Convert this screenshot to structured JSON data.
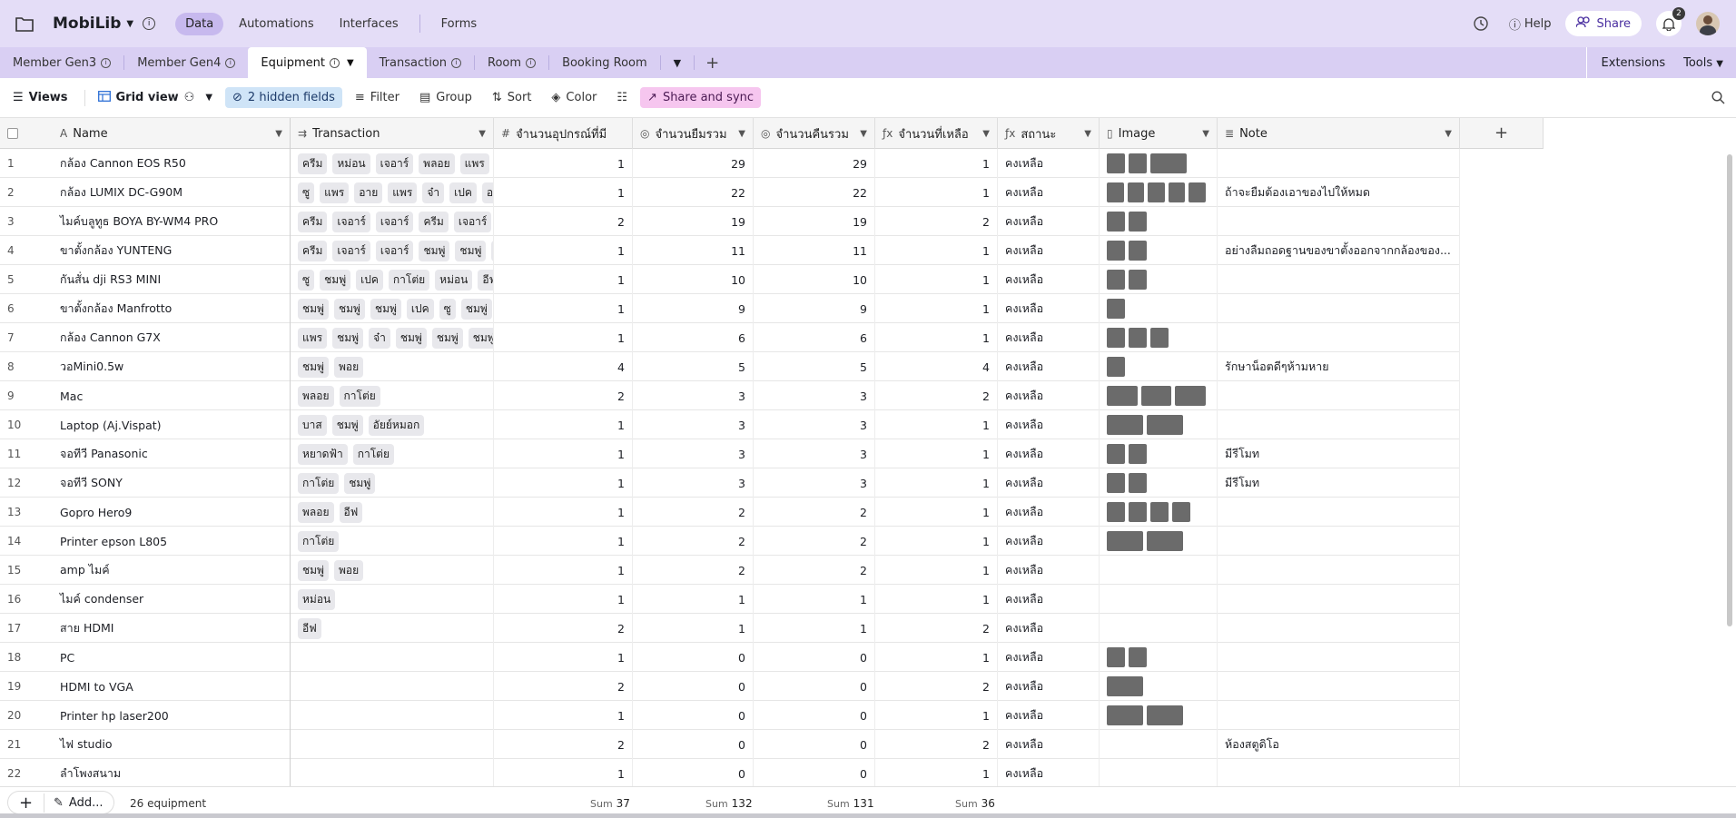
{
  "app": {
    "base_name": "MobiLib",
    "nav": [
      "Data",
      "Automations",
      "Interfaces",
      "Forms"
    ],
    "help_label": "Help",
    "share_label": "Share",
    "notification_count": "2"
  },
  "tabs": {
    "items": [
      "Member Gen3",
      "Member Gen4",
      "Equipment",
      "Transaction",
      "Room",
      "Booking Room"
    ],
    "active": "Equipment",
    "extensions_label": "Extensions",
    "tools_label": "Tools"
  },
  "toolbar": {
    "views_label": "Views",
    "grid_view_label": "Grid view",
    "hidden_fields_label": "2 hidden fields",
    "filter_label": "Filter",
    "group_label": "Group",
    "sort_label": "Sort",
    "color_label": "Color",
    "share_sync_label": "Share and sync"
  },
  "columns": [
    {
      "label": "Name",
      "icon": "A"
    },
    {
      "label": "Transaction",
      "icon": "link"
    },
    {
      "label": "จำนวนอุปกรณ์ที่มี",
      "icon": "#"
    },
    {
      "label": "จำนวนยืมรวม",
      "icon": "rollup"
    },
    {
      "label": "จำนวนคืนรวม",
      "icon": "rollup"
    },
    {
      "label": "จำนวนที่เหลือ",
      "icon": "fx"
    },
    {
      "label": "สถานะ",
      "icon": "fx"
    },
    {
      "label": "Image",
      "icon": "file"
    },
    {
      "label": "Note",
      "icon": "text"
    }
  ],
  "rows": [
    {
      "id": "1",
      "name": "กล้อง Cannon EOS R50",
      "tx": [
        "ครีม",
        "หม่อน",
        "เจอาร์",
        "พลอย",
        "แพร",
        "เจอ"
      ],
      "have": "1",
      "borrow": "29",
      "ret": "29",
      "left": "1",
      "status": "คงเหลือ",
      "images": [
        "sq",
        "sq",
        "wide"
      ],
      "note": ""
    },
    {
      "id": "2",
      "name": "กล้อง LUMIX DC-G90M",
      "tx": [
        "ซู",
        "แพร",
        "อาย",
        "แพร",
        "จ๋า",
        "เปค",
        "อาย",
        "จ"
      ],
      "have": "1",
      "borrow": "22",
      "ret": "22",
      "left": "1",
      "status": "คงเหลือ",
      "images": [
        "sq",
        "sq",
        "sq",
        "sq",
        "sq"
      ],
      "note": "ถ้าจะยืมต้องเอาของไปให้หมด"
    },
    {
      "id": "3",
      "name": "ไมค์บลูทูธ BOYA BY-WM4 PRO",
      "tx": [
        "ครีม",
        "เจอาร์",
        "เจอาร์",
        "ครีม",
        "เจอาร์",
        "พลอ"
      ],
      "have": "2",
      "borrow": "19",
      "ret": "19",
      "left": "2",
      "status": "คงเหลือ",
      "images": [
        "sq",
        "sq"
      ],
      "note": ""
    },
    {
      "id": "4",
      "name": "ขาตั้งกล้อง YUNTENG",
      "tx": [
        "ครีม",
        "เจอาร์",
        "เจอาร์",
        "ชมพู่",
        "ชมพู่",
        "ขิ่น"
      ],
      "have": "1",
      "borrow": "11",
      "ret": "11",
      "left": "1",
      "status": "คงเหลือ",
      "images": [
        "sq",
        "sq"
      ],
      "note": "อย่างลืมถอดฐานของขาตั้งออกจากกล้องของ..."
    },
    {
      "id": "5",
      "name": "กันสั่น dji RS3 MINI",
      "tx": [
        "ซู",
        "ชมพู่",
        "เปค",
        "กาโต่ย",
        "หม่อน",
        "อีฟ",
        "ซ"
      ],
      "have": "1",
      "borrow": "10",
      "ret": "10",
      "left": "1",
      "status": "คงเหลือ",
      "images": [
        "sq",
        "sq"
      ],
      "note": ""
    },
    {
      "id": "6",
      "name": "ขาตั้งกล้อง Manfrotto",
      "tx": [
        "ชมพู่",
        "ชมพู่",
        "ชมพู่",
        "เปค",
        "ซู",
        "ชมพู่",
        "ชม"
      ],
      "have": "1",
      "borrow": "9",
      "ret": "9",
      "left": "1",
      "status": "คงเหลือ",
      "images": [
        "sq"
      ],
      "note": ""
    },
    {
      "id": "7",
      "name": "กล้อง Cannon G7X",
      "tx": [
        "แพร",
        "ชมพู่",
        "จ๋า",
        "ชมพู่",
        "ชมพู่",
        "ชมพู่"
      ],
      "have": "1",
      "borrow": "6",
      "ret": "6",
      "left": "1",
      "status": "คงเหลือ",
      "images": [
        "sq",
        "sq",
        "sq"
      ],
      "note": ""
    },
    {
      "id": "8",
      "name": "วอMini0.5w",
      "tx": [
        "ชมพู่",
        "พอย"
      ],
      "have": "4",
      "borrow": "5",
      "ret": "5",
      "left": "4",
      "status": "คงเหลือ",
      "images": [
        "sq"
      ],
      "note": "รักษาน็อตดีๆห้ามหาย"
    },
    {
      "id": "9",
      "name": "Mac",
      "tx": [
        "พลอย",
        "กาโต่ย"
      ],
      "have": "2",
      "borrow": "3",
      "ret": "3",
      "left": "2",
      "status": "คงเหลือ",
      "images": [
        "wide",
        "wide",
        "wide"
      ],
      "note": ""
    },
    {
      "id": "10",
      "name": "Laptop (Aj.Vispat)",
      "tx": [
        "บาส",
        "ชมพู่",
        "อัยย์หมอก"
      ],
      "have": "1",
      "borrow": "3",
      "ret": "3",
      "left": "1",
      "status": "คงเหลือ",
      "images": [
        "wide",
        "wide"
      ],
      "note": ""
    },
    {
      "id": "11",
      "name": "จอทีวี Panasonic",
      "tx": [
        "หยาดฟ้า",
        "กาโต่ย"
      ],
      "have": "1",
      "borrow": "3",
      "ret": "3",
      "left": "1",
      "status": "คงเหลือ",
      "images": [
        "sq",
        "sq"
      ],
      "note": "มีรีโมท"
    },
    {
      "id": "12",
      "name": "จอทีวี SONY",
      "tx": [
        "กาโต่ย",
        "ชมพู่"
      ],
      "have": "1",
      "borrow": "3",
      "ret": "3",
      "left": "1",
      "status": "คงเหลือ",
      "images": [
        "sq",
        "sq"
      ],
      "note": "มีรีโมท"
    },
    {
      "id": "13",
      "name": "Gopro Hero9",
      "tx": [
        "พลอย",
        "อีฟ"
      ],
      "have": "1",
      "borrow": "2",
      "ret": "2",
      "left": "1",
      "status": "คงเหลือ",
      "images": [
        "sq",
        "sq",
        "sq",
        "sq"
      ],
      "note": ""
    },
    {
      "id": "14",
      "name": "Printer epson L805",
      "tx": [
        "กาโต่ย"
      ],
      "have": "1",
      "borrow": "2",
      "ret": "2",
      "left": "1",
      "status": "คงเหลือ",
      "images": [
        "wide",
        "wide"
      ],
      "note": ""
    },
    {
      "id": "15",
      "name": "amp ไมค์",
      "tx": [
        "ชมพู่",
        "พอย"
      ],
      "have": "1",
      "borrow": "2",
      "ret": "2",
      "left": "1",
      "status": "คงเหลือ",
      "images": [],
      "note": ""
    },
    {
      "id": "16",
      "name": "ไมค์ condenser",
      "tx": [
        "หม่อน"
      ],
      "have": "1",
      "borrow": "1",
      "ret": "1",
      "left": "1",
      "status": "คงเหลือ",
      "images": [],
      "note": ""
    },
    {
      "id": "17",
      "name": "สาย HDMI",
      "tx": [
        "อีฟ"
      ],
      "have": "2",
      "borrow": "1",
      "ret": "1",
      "left": "2",
      "status": "คงเหลือ",
      "images": [],
      "note": ""
    },
    {
      "id": "18",
      "name": "PC",
      "tx": [],
      "have": "1",
      "borrow": "0",
      "ret": "0",
      "left": "1",
      "status": "คงเหลือ",
      "images": [
        "sq",
        "sq"
      ],
      "note": ""
    },
    {
      "id": "19",
      "name": "HDMI to VGA",
      "tx": [],
      "have": "2",
      "borrow": "0",
      "ret": "0",
      "left": "2",
      "status": "คงเหลือ",
      "images": [
        "wide"
      ],
      "note": ""
    },
    {
      "id": "20",
      "name": "Printer hp laser200",
      "tx": [],
      "have": "1",
      "borrow": "0",
      "ret": "0",
      "left": "1",
      "status": "คงเหลือ",
      "images": [
        "wide",
        "wide"
      ],
      "note": ""
    },
    {
      "id": "21",
      "name": "ไฟ studio",
      "tx": [],
      "have": "2",
      "borrow": "0",
      "ret": "0",
      "left": "2",
      "status": "คงเหลือ",
      "images": [],
      "note": "ห้องสตูดิโอ"
    },
    {
      "id": "22",
      "name": "ลำโพงสนาม",
      "tx": [],
      "have": "1",
      "borrow": "0",
      "ret": "0",
      "left": "1",
      "status": "คงเหลือ",
      "images": [],
      "note": ""
    }
  ],
  "footer": {
    "add_label": "Add...",
    "record_count": "26 equipment",
    "sum_label": "Sum",
    "sums": [
      "37",
      "132",
      "131",
      "36"
    ]
  }
}
